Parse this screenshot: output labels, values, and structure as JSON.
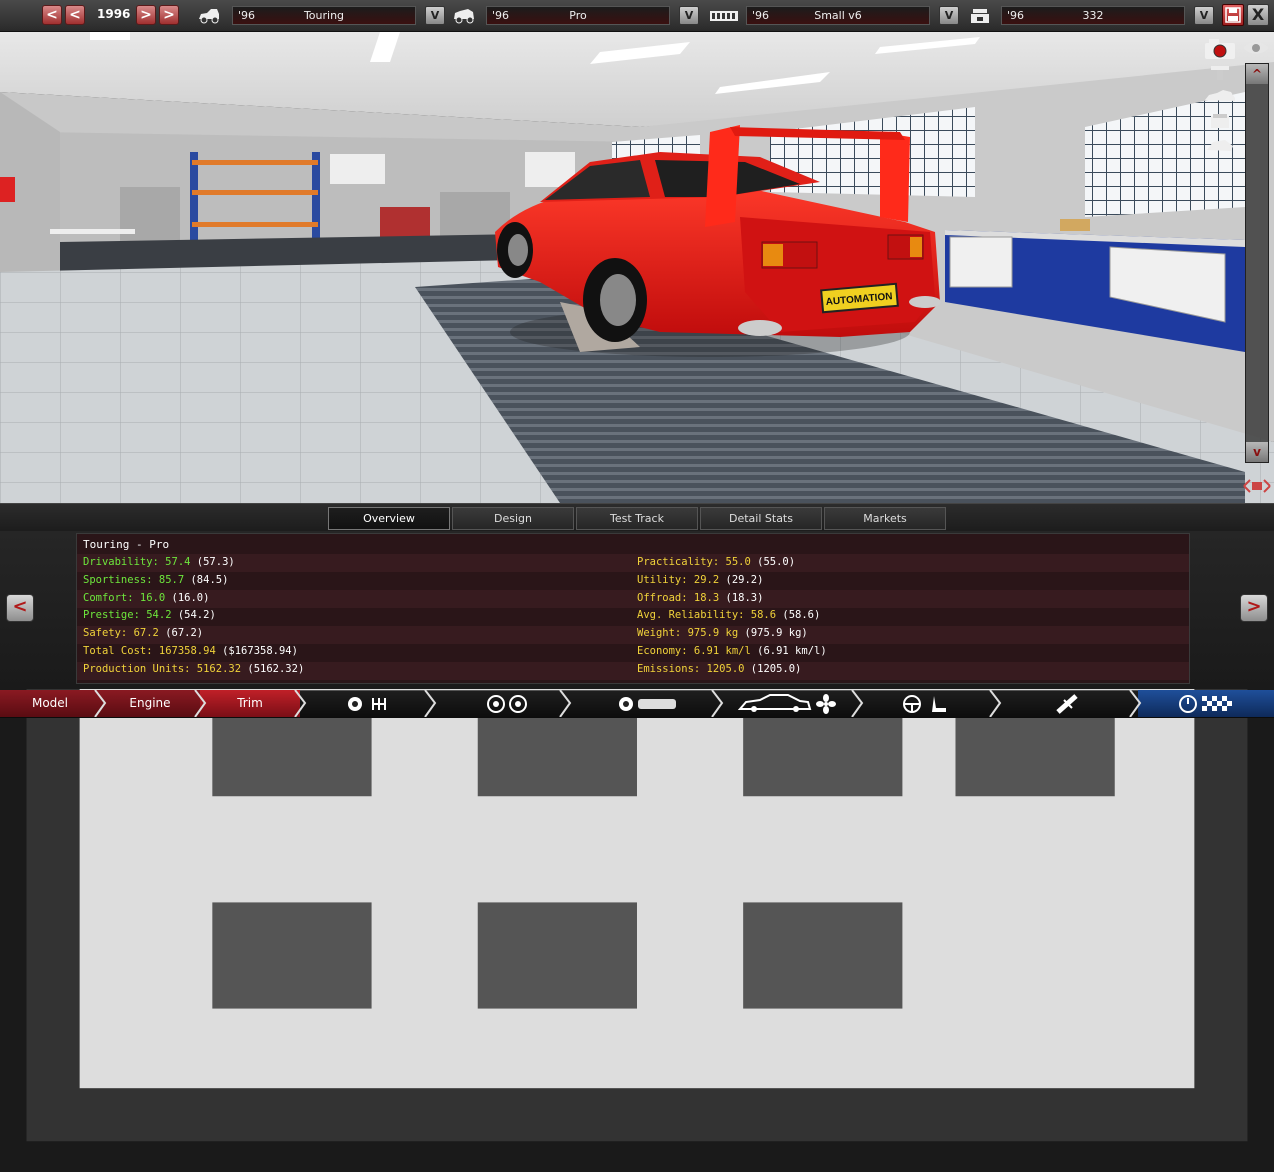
{
  "topbar": {
    "year": "1996",
    "prev_label": "<",
    "next_label": ">",
    "selectors": [
      {
        "year": "'96",
        "name": "Touring",
        "btn": "V"
      },
      {
        "year": "'96",
        "name": "Pro",
        "btn": "V"
      },
      {
        "year": "'96",
        "name": "Small v6",
        "btn": "V"
      },
      {
        "year": "'96",
        "name": "332",
        "btn": "V"
      }
    ],
    "close_label": "X"
  },
  "scrollbar": {
    "up": "^",
    "down": "v"
  },
  "tabs": [
    {
      "label": "Overview",
      "active": true
    },
    {
      "label": "Design",
      "active": false
    },
    {
      "label": "Test Track",
      "active": false
    },
    {
      "label": "Detail Stats",
      "active": false
    },
    {
      "label": "Markets",
      "active": false
    }
  ],
  "info": {
    "title": "Touring - Pro",
    "left": [
      {
        "label": "Drivability:",
        "value": "57.4",
        "paren": "(57.3)",
        "color": "green"
      },
      {
        "label": "Sportiness:",
        "value": "85.7",
        "paren": "(84.5)",
        "color": "green"
      },
      {
        "label": "Comfort:",
        "value": "16.0",
        "paren": "(16.0)",
        "color": "green"
      },
      {
        "label": "Prestige:",
        "value": "54.2",
        "paren": "(54.2)",
        "color": "green"
      },
      {
        "label": "Safety:",
        "value": "67.2",
        "paren": "(67.2)",
        "color": "yellow"
      },
      {
        "label": "Total Cost:",
        "value": "167358.94",
        "paren": "($167358.94)",
        "color": "yellow"
      },
      {
        "label": "Production Units:",
        "value": "5162.32",
        "paren": "(5162.32)",
        "color": "yellow"
      }
    ],
    "right": [
      {
        "label": "Practicality:",
        "value": "55.0",
        "paren": "(55.0)",
        "color": "yellow"
      },
      {
        "label": "Utility:",
        "value": "29.2",
        "paren": "(29.2)",
        "color": "yellow"
      },
      {
        "label": "Offroad:",
        "value": "18.3",
        "paren": "(18.3)",
        "color": "yellow"
      },
      {
        "label": "Avg. Reliability:",
        "value": "58.6",
        "paren": "(58.6)",
        "color": "yellow"
      },
      {
        "label": "Weight:",
        "value": "975.9 kg",
        "paren": "(975.9 kg)",
        "color": "yellow"
      },
      {
        "label": "Economy:",
        "value": "6.91 km/l",
        "paren": "(6.91 km/l)",
        "color": "yellow"
      },
      {
        "label": "Emissions:",
        "value": "1205.0",
        "paren": "(1205.0)",
        "color": "yellow"
      }
    ]
  },
  "nav": {
    "left_arrow": "<",
    "right_arrow": ">"
  },
  "bottom": {
    "model": "Model",
    "engine": "Engine",
    "trim": "Trim"
  },
  "scene": {
    "license_plate": "AUTOMATION"
  },
  "colors": {
    "green": "#6ee63c",
    "yellow": "#f0d23a",
    "accent_red": "#c02028",
    "car_red": "#e81818"
  }
}
